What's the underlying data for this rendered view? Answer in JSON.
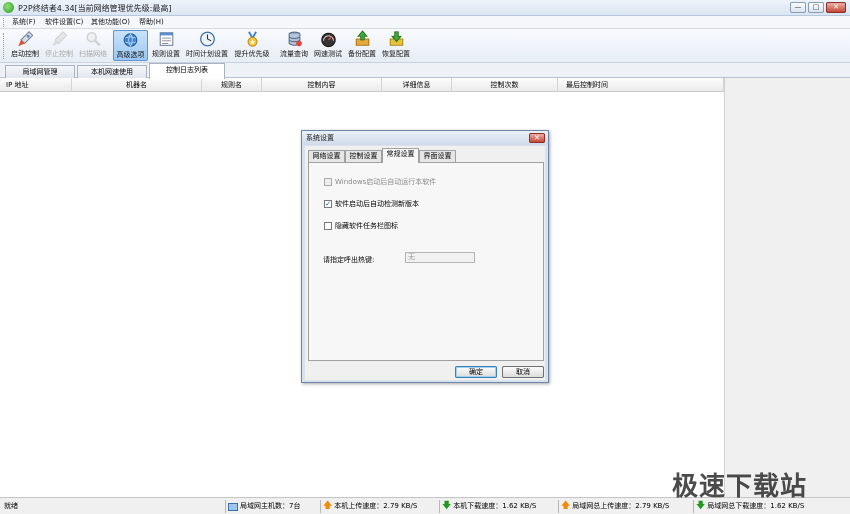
{
  "window": {
    "title": "P2P终结者4.34[当前网络管理优先级:最高]",
    "minimize": "—",
    "maximize": "□",
    "close": "✕"
  },
  "menu": [
    "系统(F)",
    "软件设置(C)",
    "其他功能(O)",
    "帮助(H)"
  ],
  "toolbar": [
    {
      "label": "启动控制",
      "icon": "rocket-icon",
      "state": "normal"
    },
    {
      "label": "停止控制",
      "icon": "stop-icon",
      "state": "disabled"
    },
    {
      "label": "扫描网络",
      "icon": "magnifier-icon",
      "state": "disabled"
    },
    {
      "label": "高级选项",
      "icon": "globe-icon",
      "state": "active"
    },
    {
      "label": "规则设置",
      "icon": "rules-icon",
      "state": "normal"
    },
    {
      "label": "时间计划设置",
      "icon": "clock-icon",
      "state": "normal"
    },
    {
      "label": "提升优先级",
      "icon": "medal-icon",
      "state": "normal"
    },
    {
      "label": "流量查询",
      "icon": "database-icon",
      "state": "normal"
    },
    {
      "label": "网速测试",
      "icon": "speedometer-icon",
      "state": "normal"
    },
    {
      "label": "备份配置",
      "icon": "backup-icon",
      "state": "normal"
    },
    {
      "label": "恢复配置",
      "icon": "restore-icon",
      "state": "normal"
    }
  ],
  "tabs": [
    "局域网管理",
    "本机网速使用",
    "控制日志列表"
  ],
  "active_tab_index": 2,
  "table": {
    "columns": [
      "IP 地址",
      "机器名",
      "规则名",
      "控制内容",
      "详细信息",
      "控制次数",
      "最后控制时间"
    ]
  },
  "dialog": {
    "title": "系统设置",
    "close": "✕",
    "tabs": [
      "网络设置",
      "控制设置",
      "常规设置",
      "界面设置"
    ],
    "active_tab_index": 2,
    "options": [
      {
        "label": "Windows启动后自动运行本软件",
        "checked": false,
        "disabled": true
      },
      {
        "label": "软件启动后自动检测新版本",
        "checked": true,
        "disabled": false
      },
      {
        "label": "隐藏软件任务栏图标",
        "checked": false,
        "disabled": false
      }
    ],
    "hotkey_label": "请指定呼出热键:",
    "hotkey_value": "无",
    "ok": "确定",
    "cancel": "取消"
  },
  "status": {
    "ready": "就绪",
    "hosts": "局域网主机数：7台",
    "local_up": "本机上传速度：2.79 KB/S",
    "local_down": "本机下载速度：1.62 KB/S",
    "lan_up": "局域网总上传速度：2.79 KB/S",
    "lan_down": "局域网总下载速度：1.62 KB/S"
  },
  "watermark": "极速下载站",
  "colors": {
    "accent": "#5e93cc",
    "upload_arrow": "#f08a00",
    "download_arrow": "#1f9a1f"
  }
}
